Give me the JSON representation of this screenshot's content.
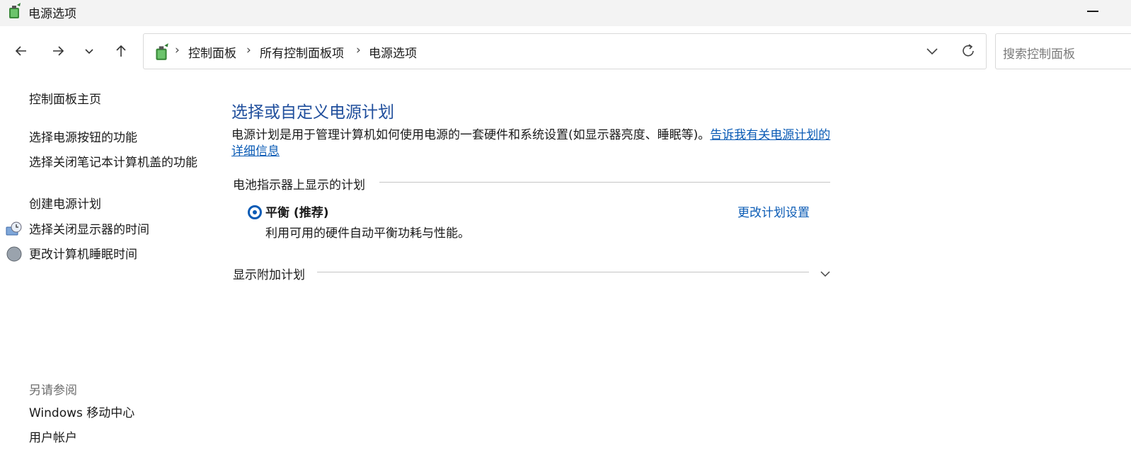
{
  "window": {
    "title": "电源选项",
    "icon": "power-options-icon"
  },
  "nav": {
    "back_icon": "arrow-left-icon",
    "forward_icon": "arrow-right-icon",
    "history_icon": "chevron-down-icon",
    "up_icon": "arrow-up-icon"
  },
  "address": {
    "crumbs": [
      "控制面板",
      "所有控制面板项",
      "电源选项"
    ],
    "separator": "›"
  },
  "search": {
    "placeholder": "搜索控制面板"
  },
  "sidebar": {
    "home": "控制面板主页",
    "items": [
      {
        "label": "选择电源按钮的功能"
      },
      {
        "label": "选择关闭笔记本计算机盖的功能"
      },
      {
        "label": "创建电源计划"
      },
      {
        "label": "选择关闭显示器的时间",
        "icon": "monitor-clock-icon"
      },
      {
        "label": "更改计算机睡眠时间",
        "icon": "moon-icon"
      }
    ],
    "see_also_title": "另请参阅",
    "see_also": [
      {
        "label": "Windows 移动中心"
      },
      {
        "label": "用户帐户"
      }
    ]
  },
  "main": {
    "heading": "选择或自定义电源计划",
    "description": "电源计划是用于管理计算机如何使用电源的一套硬件和系统设置(如显示器亮度、睡眠等)。",
    "description_link": "告诉我有关电源计划的详细信息",
    "group_battery": "电池指示器上显示的计划",
    "plan": {
      "name": "平衡 (推荐)",
      "description": "利用可用的硬件自动平衡功耗与性能。",
      "selected": true,
      "change_link": "更改计划设置"
    },
    "group_additional": "显示附加计划"
  },
  "colors": {
    "link": "#0a5bb5",
    "heading": "#1f4e9c",
    "muted": "#6d6d6d"
  }
}
